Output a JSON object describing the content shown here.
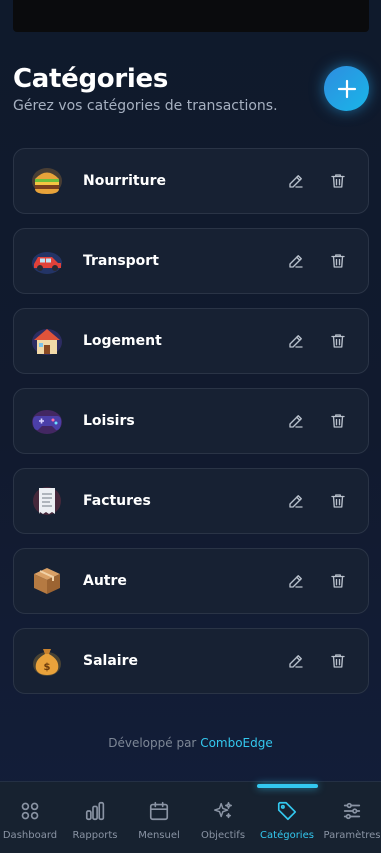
{
  "header": {
    "title": "Catégories",
    "subtitle": "Gérez vos catégories de transactions."
  },
  "add_button": {
    "icon": "plus-icon"
  },
  "categories": [
    {
      "name": "Nourriture",
      "emoji": "burger"
    },
    {
      "name": "Transport",
      "emoji": "car"
    },
    {
      "name": "Logement",
      "emoji": "house"
    },
    {
      "name": "Loisirs",
      "emoji": "gamepad"
    },
    {
      "name": "Factures",
      "emoji": "receipt"
    },
    {
      "name": "Autre",
      "emoji": "package"
    },
    {
      "name": "Salaire",
      "emoji": "money-bag"
    }
  ],
  "footer": {
    "prefix": "Développé par",
    "brand": "ComboEdge"
  },
  "nav": {
    "items": [
      {
        "label": "Dashboard",
        "icon": "grid-icon"
      },
      {
        "label": "Rapports",
        "icon": "bar-chart-icon"
      },
      {
        "label": "Mensuel",
        "icon": "calendar-icon"
      },
      {
        "label": "Objectifs",
        "icon": "sparkles-icon"
      },
      {
        "label": "Catégories",
        "icon": "tag-icon"
      },
      {
        "label": "Paramètres",
        "icon": "sliders-icon"
      }
    ],
    "active": "Catégories"
  },
  "colors": {
    "accent": "#33c8ef",
    "background": "#111a2e",
    "card": "#172133"
  }
}
